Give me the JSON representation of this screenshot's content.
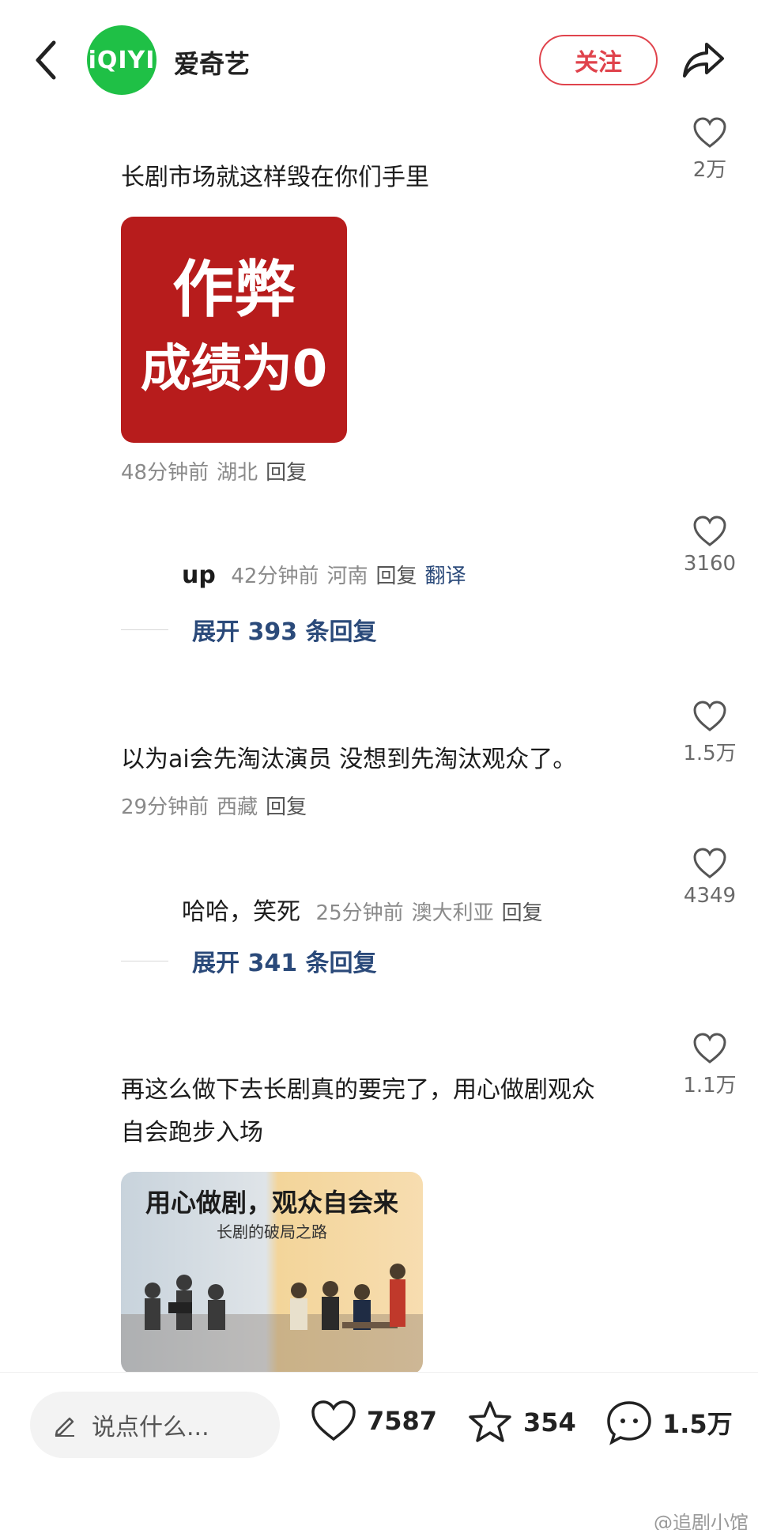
{
  "header": {
    "account_name": "爱奇艺",
    "avatar_text": "iQIYI",
    "follow_label": "关注"
  },
  "comments": [
    {
      "text": "长剧市场就这样毁在你们手里",
      "image_lines": [
        "作弊",
        "成绩为0"
      ],
      "time": "48分钟前",
      "location": "湖北",
      "reply": "回复",
      "likes": "2万"
    },
    {
      "author": "up",
      "time": "42分钟前",
      "location": "河南",
      "reply": "回复",
      "translate": "翻译",
      "likes": "3160",
      "expand": "展开 393 条回复"
    },
    {
      "text": "以为ai会先淘汰演员 没想到先淘汰观众了。",
      "time": "29分钟前",
      "location": "西藏",
      "reply": "回复",
      "likes": "1.5万"
    },
    {
      "author": "哈哈，笑死",
      "time": "25分钟前",
      "location": "澳大利亚",
      "reply": "回复",
      "likes": "4349",
      "expand": "展开 341 条回复"
    },
    {
      "text_line1": "再这么做下去长剧真的要完了，用心做剧观众",
      "text_line2": "自会跑步入场",
      "poster_title": "用心做剧，观众自会来",
      "poster_subtitle": "长剧的破局之路",
      "likes": "1.1万"
    }
  ],
  "bottom_bar": {
    "placeholder": "说点什么...",
    "likes": "7587",
    "favorites": "354",
    "comments": "1.5万",
    "watermark": "@追剧小馆"
  }
}
